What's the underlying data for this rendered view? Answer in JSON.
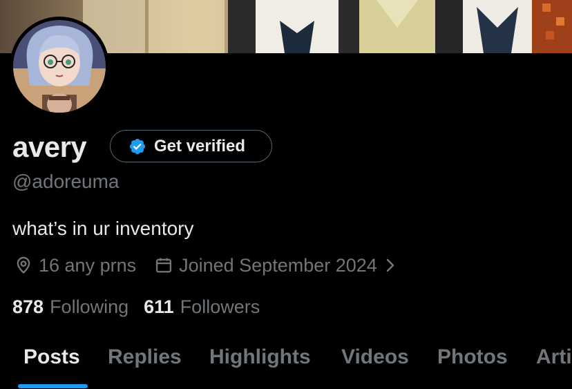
{
  "profile": {
    "display_name": "avery",
    "handle": "@adoreuma",
    "bio": "what’s in ur inventory",
    "location": "16 any prns",
    "joined": "Joined September 2024"
  },
  "verify": {
    "label": "Get verified",
    "icon": "verified-badge-icon",
    "color": "#1d9bf0"
  },
  "stats": {
    "following_count": "878",
    "following_label": "Following",
    "followers_count": "611",
    "followers_label": "Followers"
  },
  "tabs": [
    {
      "label": "Posts",
      "active": true
    },
    {
      "label": "Replies",
      "active": false
    },
    {
      "label": "Highlights",
      "active": false
    },
    {
      "label": "Videos",
      "active": false
    },
    {
      "label": "Photos",
      "active": false
    },
    {
      "label": "Arti",
      "active": false
    }
  ],
  "icons": {
    "location": "location-pin-icon",
    "calendar": "calendar-icon",
    "chevron": "chevron-right-icon"
  },
  "colors": {
    "background": "#000000",
    "text_primary": "#e7e9ea",
    "text_secondary": "#71767b",
    "accent": "#1d9bf0",
    "border": "#536471"
  }
}
